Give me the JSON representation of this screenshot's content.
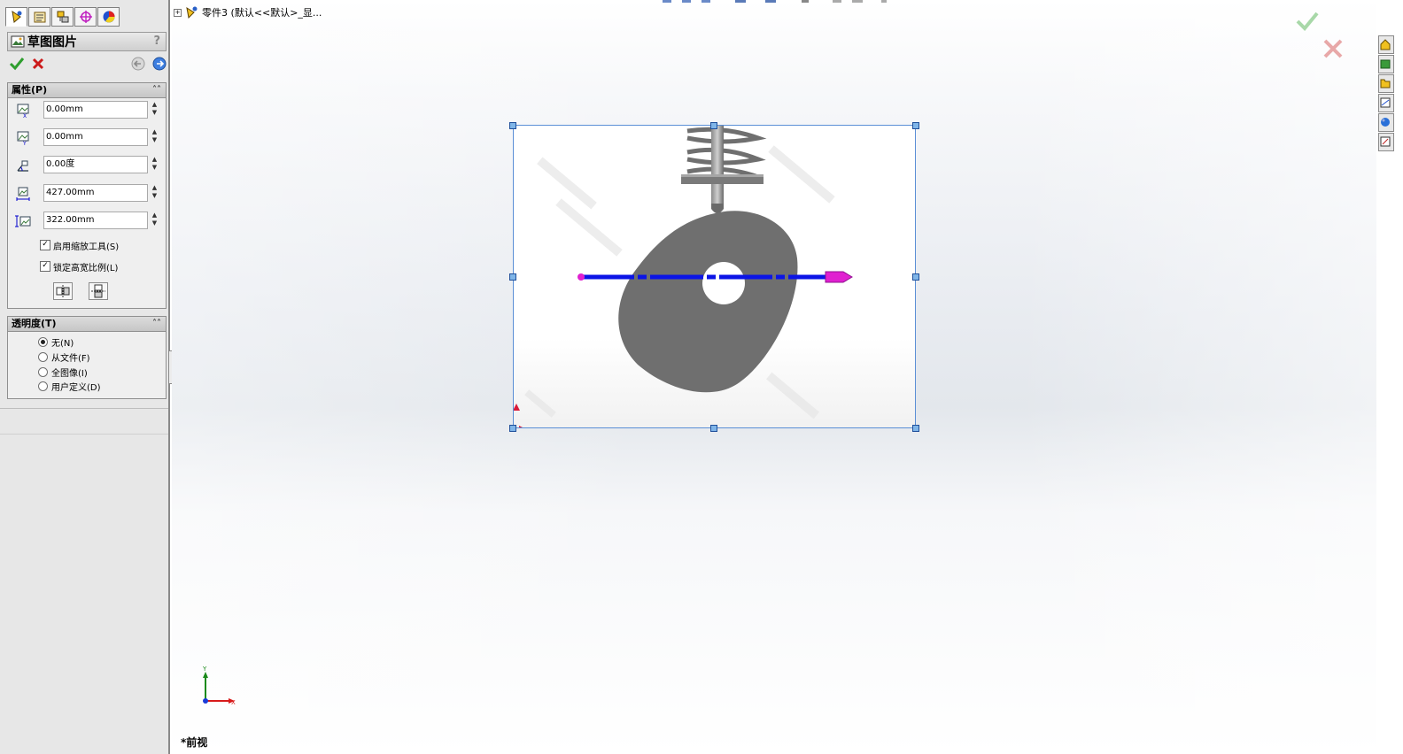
{
  "tabs": [
    {
      "name": "feature-manager-tab-icon",
      "active": true
    },
    {
      "name": "property-manager-tab-icon",
      "active": false
    },
    {
      "name": "configuration-manager-tab-icon",
      "active": false
    },
    {
      "name": "dimxpert-manager-tab-icon",
      "active": false
    },
    {
      "name": "display-manager-tab-icon",
      "active": false
    }
  ],
  "property_manager": {
    "title": "草图图片",
    "help": "?"
  },
  "properties_group": {
    "header": "属性(P)",
    "x_position": "0.00mm",
    "y_position": "0.00mm",
    "angle": "0.00度",
    "width": "427.00mm",
    "height": "322.00mm",
    "enable_scale_tool": {
      "label": "启用缩放工具(S)",
      "checked": true
    },
    "lock_aspect_ratio": {
      "label": "锁定高宽比例(L)",
      "checked": true
    }
  },
  "transparency_group": {
    "header": "透明度(T)",
    "options": [
      {
        "label": "无(N)",
        "checked": true
      },
      {
        "label": "从文件(F)",
        "checked": false
      },
      {
        "label": "全图像(I)",
        "checked": false
      },
      {
        "label": "用户定义(D)",
        "checked": false
      }
    ]
  },
  "tree": {
    "expand": "+",
    "part_label": "零件3 (默认<<默认>_显..."
  },
  "viewport": {
    "view_label": "*前视",
    "triad": {
      "x": "X",
      "y": "Y"
    }
  },
  "colors": {
    "accept": "#2e9e2e",
    "cancel": "#cc1a1a",
    "selection_frame": "#5b8fd6",
    "axis_line": "#0b14e6",
    "arrow": "#e020d0"
  }
}
